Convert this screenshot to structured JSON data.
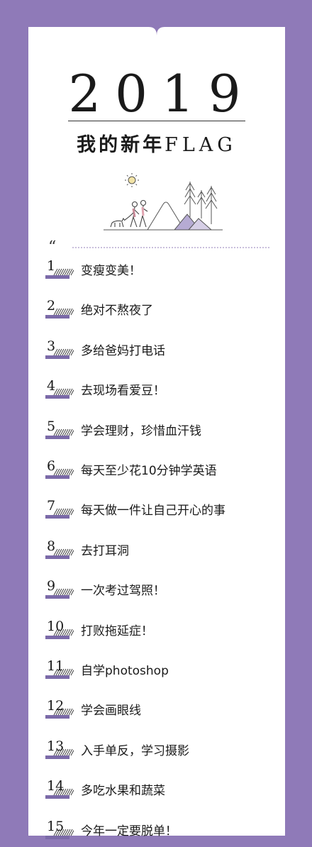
{
  "header": {
    "year": "2019",
    "title_cn": "我的新年",
    "title_latin": "FLAG"
  },
  "quote_mark": "“",
  "illustration": {
    "name": "hikers-with-dog-landscape",
    "accent": "#8f7ab8"
  },
  "colors": {
    "background": "#8f7ab8",
    "card": "#ffffff",
    "accent": "#7b6aa8"
  },
  "items": [
    {
      "num": "1",
      "text": "变瘦变美！"
    },
    {
      "num": "2",
      "text": "绝对不熬夜了"
    },
    {
      "num": "3",
      "text": "多给爸妈打电话"
    },
    {
      "num": "4",
      "text": "去现场看爱豆！"
    },
    {
      "num": "5",
      "text": "学会理财，珍惜血汗钱"
    },
    {
      "num": "6",
      "text": "每天至少花10分钟学英语"
    },
    {
      "num": "7",
      "text": "每天做一件让自己开心的事"
    },
    {
      "num": "8",
      "text": "去打耳洞"
    },
    {
      "num": "9",
      "text": "一次考过驾照！"
    },
    {
      "num": "10",
      "text": "打败拖延症！"
    },
    {
      "num": "11",
      "text": "自学photoshop"
    },
    {
      "num": "12",
      "text": "学会画眼线"
    },
    {
      "num": "13",
      "text": "入手单反，学习摄影"
    },
    {
      "num": "14",
      "text": "多吃水果和蔬菜"
    },
    {
      "num": "15",
      "text": "今年一定要脱单！"
    }
  ]
}
